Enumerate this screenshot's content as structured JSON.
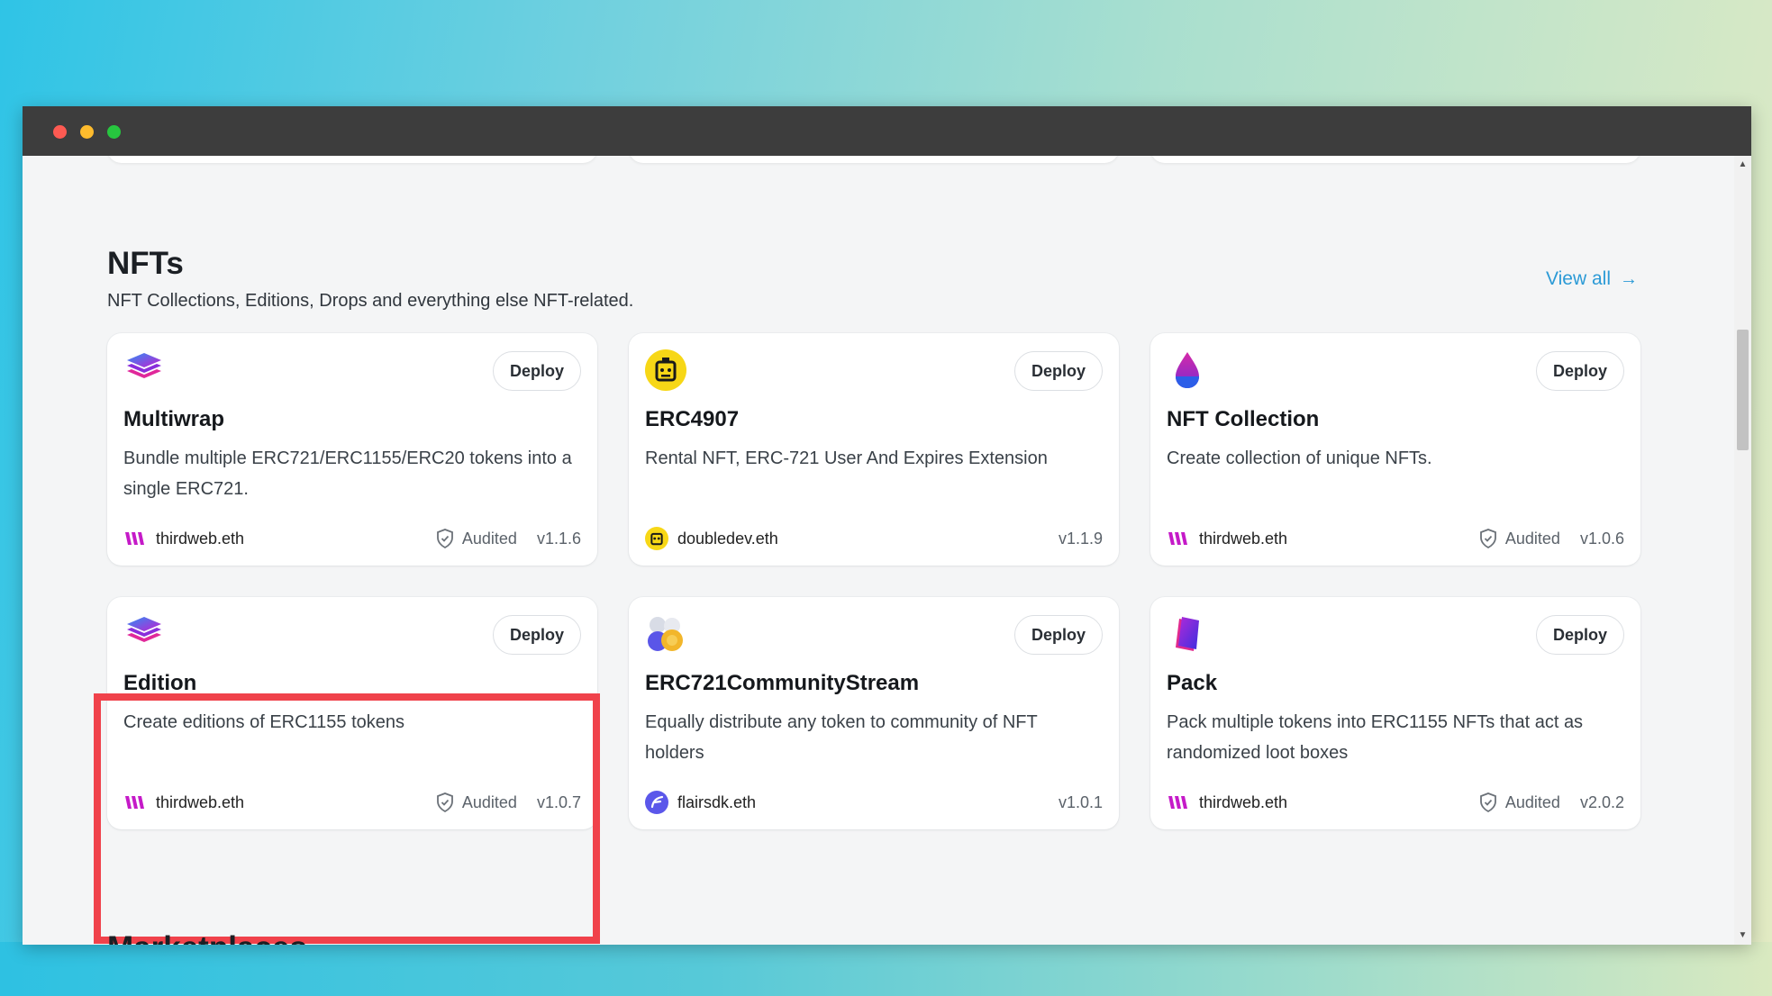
{
  "section": {
    "title": "NFTs",
    "subtitle": "NFT Collections, Editions, Drops and everything else NFT-related.",
    "view_all": "View all"
  },
  "cards": [
    {
      "title": "Multiwrap",
      "description": "Bundle multiple ERC721/ERC1155/ERC20 tokens into a single ERC721.",
      "deploy": "Deploy",
      "publisher": "thirdweb.eth",
      "audited": "Audited",
      "version": "v1.1.6",
      "icon": "layers-icon"
    },
    {
      "title": "ERC4907",
      "description": "Rental NFT, ERC-721 User And Expires Extension",
      "deploy": "Deploy",
      "publisher": "doubledev.eth",
      "audited": "",
      "version": "v1.1.9",
      "icon": "robot-icon"
    },
    {
      "title": "NFT Collection",
      "description": "Create collection of unique NFTs.",
      "deploy": "Deploy",
      "publisher": "thirdweb.eth",
      "audited": "Audited",
      "version": "v1.0.6",
      "icon": "drop-icon"
    },
    {
      "title": "Edition",
      "description": "Create editions of ERC1155 tokens",
      "deploy": "Deploy",
      "publisher": "thirdweb.eth",
      "audited": "Audited",
      "version": "v1.0.7",
      "icon": "layers-icon"
    },
    {
      "title": "ERC721CommunityStream",
      "description": "Equally distribute any token to community of NFT holders",
      "deploy": "Deploy",
      "publisher": "flairsdk.eth",
      "audited": "",
      "version": "v1.0.1",
      "icon": "coins-icon"
    },
    {
      "title": "Pack",
      "description": "Pack multiple tokens into ERC1155 NFTs that act as randomized loot boxes",
      "deploy": "Deploy",
      "publisher": "thirdweb.eth",
      "audited": "Audited",
      "version": "v2.0.2",
      "icon": "pack-icon"
    }
  ],
  "next_section": {
    "title": "Marketplaces"
  },
  "colors": {
    "accent": "#2b9ad6",
    "highlight": "#f0424b",
    "thirdweb_logo": "#c51ac8"
  }
}
